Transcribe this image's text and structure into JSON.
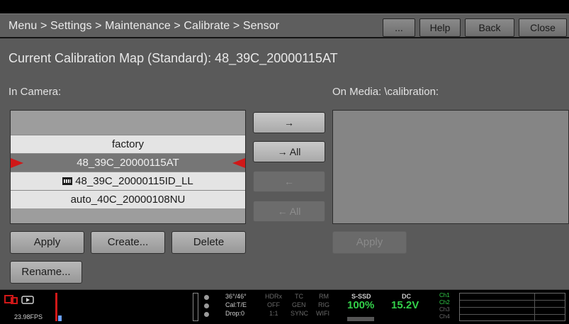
{
  "header": {
    "breadcrumb": "Menu > Settings > Maintenance > Calibrate > Sensor",
    "more_label": "...",
    "help_label": "Help",
    "back_label": "Back",
    "close_label": "Close"
  },
  "main": {
    "current_map": "Current Calibration Map (Standard): 48_39C_20000115AT",
    "in_camera_label": "In Camera:",
    "on_media_label": "On Media: \\calibration:",
    "camera_items": [
      {
        "label": "factory"
      },
      {
        "label": "48_39C_20000115AT",
        "selected": true
      },
      {
        "label": "48_39C_20000115ID_LL",
        "icon": "film-icon"
      },
      {
        "label": "auto_40C_20000108NU"
      }
    ],
    "transfer": {
      "copy_to_media": "→",
      "copy_all_to_media": "→ All",
      "copy_to_camera": "←",
      "copy_all_to_camera": "← All"
    },
    "actions": {
      "apply": "Apply",
      "create": "Create...",
      "delete": "Delete",
      "rename": "Rename...",
      "media_apply": "Apply"
    }
  },
  "status": {
    "fps": "23.98FPS",
    "temp": "36°/46°",
    "cal": "Cal:T/E",
    "drop": "Drop:0",
    "hdrx": "HDRx",
    "off": "OFF",
    "ratio": "1:1",
    "tc": "TC",
    "gen": "GEN",
    "sync": "SYNC",
    "rm": "RM",
    "rig": "RIG",
    "wifi": "WIFI",
    "media_label": "S-SSD",
    "media_pct": "100%",
    "dc_label": "DC",
    "dc_voltage": "15.2V",
    "ch1": "Ch1",
    "ch2": "Ch2",
    "ch3": "Ch3",
    "ch4": "Ch4"
  },
  "colors": {
    "accent_red": "#d01818",
    "status_green": "#33d14a"
  }
}
